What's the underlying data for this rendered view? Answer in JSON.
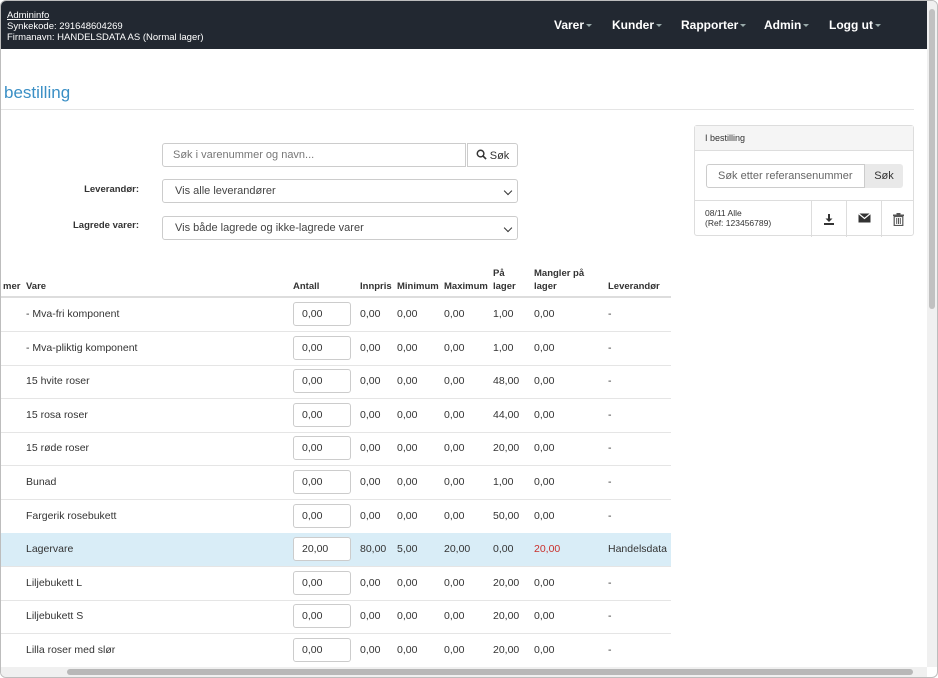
{
  "header": {
    "admin_link": "Admininfo",
    "sync_code": "Synkekode: 291648604269",
    "company": "Firmanavn: HANDELSDATA AS (Normal lager)",
    "nav": [
      {
        "label": "Varer"
      },
      {
        "label": "Kunder"
      },
      {
        "label": "Rapporter"
      },
      {
        "label": "Admin"
      },
      {
        "label": "Logg ut"
      }
    ]
  },
  "page": {
    "title": "bestilling"
  },
  "search": {
    "placeholder": "Søk i varenummer og navn...",
    "button": "Søk"
  },
  "filters": {
    "supplier_label": "Leverandør:",
    "supplier_value": "Vis alle leverandører",
    "stored_label": "Lagrede varer:",
    "stored_value": "Vis både lagrede og ikke-lagrede varer"
  },
  "table": {
    "headers": {
      "nr": "mer",
      "vare": "Vare",
      "antall": "Antall",
      "innpris": "Innpris",
      "minimum": "Minimum",
      "maximum": "Maximum",
      "pa_lager_1": "På",
      "pa_lager_2": "lager",
      "mangler_1": "Mangler på",
      "mangler_2": "lager",
      "leverandor": "Leverandør"
    },
    "rows": [
      {
        "vare": "- Mva-fri komponent",
        "antall": "0,00",
        "innpris": "0,00",
        "minimum": "0,00",
        "maximum": "0,00",
        "pa_lager": "1,00",
        "mangler": "0,00",
        "leverandor": "-"
      },
      {
        "vare": "- Mva-pliktig komponent",
        "antall": "0,00",
        "innpris": "0,00",
        "minimum": "0,00",
        "maximum": "0,00",
        "pa_lager": "1,00",
        "mangler": "0,00",
        "leverandor": "-"
      },
      {
        "vare": "15 hvite roser",
        "antall": "0,00",
        "innpris": "0,00",
        "minimum": "0,00",
        "maximum": "0,00",
        "pa_lager": "48,00",
        "mangler": "0,00",
        "leverandor": "-"
      },
      {
        "vare": "15 rosa roser",
        "antall": "0,00",
        "innpris": "0,00",
        "minimum": "0,00",
        "maximum": "0,00",
        "pa_lager": "44,00",
        "mangler": "0,00",
        "leverandor": "-"
      },
      {
        "vare": "15 røde roser",
        "antall": "0,00",
        "innpris": "0,00",
        "minimum": "0,00",
        "maximum": "0,00",
        "pa_lager": "20,00",
        "mangler": "0,00",
        "leverandor": "-"
      },
      {
        "vare": "Bunad",
        "antall": "0,00",
        "innpris": "0,00",
        "minimum": "0,00",
        "maximum": "0,00",
        "pa_lager": "1,00",
        "mangler": "0,00",
        "leverandor": "-"
      },
      {
        "vare": "Fargerik rosebukett",
        "antall": "0,00",
        "innpris": "0,00",
        "minimum": "0,00",
        "maximum": "0,00",
        "pa_lager": "50,00",
        "mangler": "0,00",
        "leverandor": "-"
      },
      {
        "vare": "Lagervare",
        "antall": "20,00",
        "innpris": "80,00",
        "minimum": "5,00",
        "maximum": "20,00",
        "pa_lager": "0,00",
        "mangler": "20,00",
        "leverandor": "Handelsdata",
        "highlight": true
      },
      {
        "vare": "Liljebukett L",
        "antall": "0,00",
        "innpris": "0,00",
        "minimum": "0,00",
        "maximum": "0,00",
        "pa_lager": "20,00",
        "mangler": "0,00",
        "leverandor": "-"
      },
      {
        "vare": "Liljebukett S",
        "antall": "0,00",
        "innpris": "0,00",
        "minimum": "0,00",
        "maximum": "0,00",
        "pa_lager": "20,00",
        "mangler": "0,00",
        "leverandor": "-"
      },
      {
        "vare": "Lilla roser med slør",
        "antall": "0,00",
        "innpris": "0,00",
        "minimum": "0,00",
        "maximum": "0,00",
        "pa_lager": "20,00",
        "mangler": "0,00",
        "leverandor": "-"
      }
    ]
  },
  "side_panel": {
    "title": "I bestilling",
    "ref_placeholder": "Søk etter referansenummer",
    "ref_button": "Søk",
    "order_line1": "08/11 Alle",
    "order_line2": "(Ref: 123456789)",
    "icons": [
      "download-icon",
      "envelope-icon",
      "trash-icon"
    ]
  },
  "colors": {
    "navbar": "#222831",
    "title": "#3a8fc5",
    "highlight_row": "#d9edf7",
    "alert_text": "#c9302c"
  }
}
